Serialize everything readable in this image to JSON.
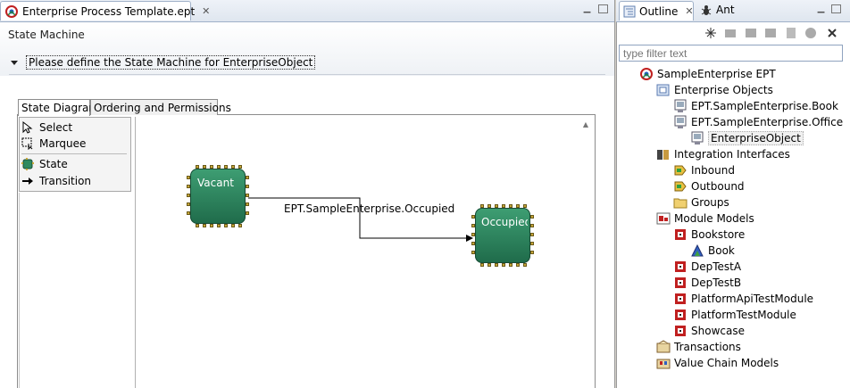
{
  "editor": {
    "tab_title": "Enterprise Process Template.ept",
    "form_title": "State Machine",
    "section_label": "Please define the State Machine for EnterpriseObject",
    "inner_tabs": [
      "State Diagram",
      "Ordering and Permissions"
    ],
    "palette": {
      "select": "Select",
      "marquee": "Marquee",
      "state": "State",
      "transition": "Transition"
    },
    "diagram": {
      "states": [
        "Vacant",
        "Occupied"
      ],
      "transition_label": "EPT.SampleEnterprise.Occupied"
    }
  },
  "outline": {
    "tab_outline": "Outline",
    "tab_ant": "Ant",
    "filter_placeholder": "type filter text",
    "tree": {
      "root": "SampleEnterprise EPT",
      "enterprise_objects": "Enterprise Objects",
      "eo_book": "EPT.SampleEnterprise.Book",
      "eo_office": "EPT.SampleEnterprise.Office",
      "eo_object": "EnterpriseObject",
      "integration_interfaces": "Integration Interfaces",
      "inbound": "Inbound",
      "outbound": "Outbound",
      "groups": "Groups",
      "module_models": "Module Models",
      "bookstore": "Bookstore",
      "book": "Book",
      "deptesta": "DepTestA",
      "deptestb": "DepTestB",
      "platformapi": "PlatformApiTestModule",
      "platformtest": "PlatformTestModule",
      "showcase": "Showcase",
      "transactions": "Transactions",
      "value_chain": "Value Chain Models"
    }
  },
  "colors": {
    "node_fill": "#2f8a5f",
    "pin": "#c8a838",
    "tab_border": "#9fb0c8"
  }
}
